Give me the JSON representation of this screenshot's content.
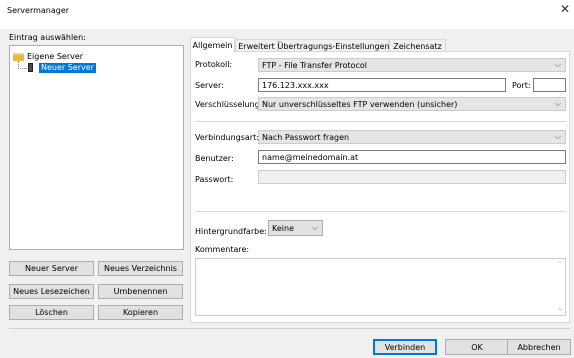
{
  "window": {
    "title": "Servermanager",
    "close_symbol": "✕"
  },
  "left": {
    "label": "Eintrag auswählen:",
    "tree": {
      "root": "Eigene Server",
      "child": "Neuer Server"
    },
    "buttons": {
      "new_server": "Neuer Server",
      "new_folder": "Neues Verzeichnis",
      "new_bookmark": "Neues Lesezeichen",
      "rename": "Umbenennen",
      "delete": "Löschen",
      "copy": "Kopieren"
    }
  },
  "tabs": [
    "Allgemein",
    "Erweitert",
    "Übertragungs-Einstellungen",
    "Zeichensatz"
  ],
  "general": {
    "protocol_label": "Protokoll:",
    "protocol_value": "FTP - File Transfer Protocol",
    "server_label": "Server:",
    "server_value": "176.123.xxx.xxx",
    "port_label": "Port:",
    "port_value": "",
    "encryption_label": "Verschlüsselung:",
    "encryption_value": "Nur unverschlüsseltes FTP verwenden (unsicher)",
    "logon_label": "Verbindungsart:",
    "logon_value": "Nach Passwort fragen",
    "user_label": "Benutzer:",
    "user_value": "name@meinedomain.at",
    "password_label": "Passwort:",
    "password_value": "",
    "bg_label": "Hintergrundfarbe:",
    "bg_value": "Keine",
    "comments_label": "Kommentare:",
    "comments_value": ""
  },
  "footer": {
    "connect": "Verbinden",
    "ok": "OK",
    "cancel": "Abbrechen"
  },
  "icons": {
    "chevron": "⌵",
    "scroll_up": "^",
    "scroll_down": "v"
  },
  "colors": {
    "selection": "#0078d7",
    "folder": "#e8b93a"
  }
}
